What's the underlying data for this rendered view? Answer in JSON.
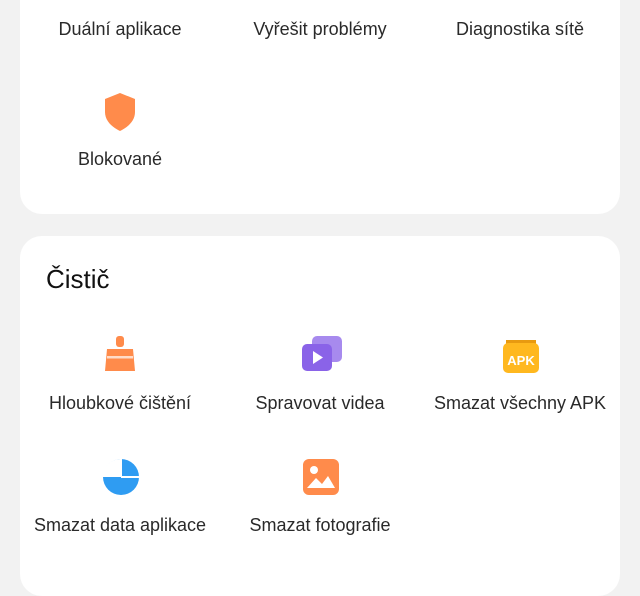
{
  "colors": {
    "page_background": "#f2f2f2",
    "card_background": "#ffffff",
    "orange": "#ff8b4b",
    "yellow": "#ffb81f",
    "blue": "#2f9cf2",
    "purple": "#8a63e8"
  },
  "top_section": {
    "items": [
      {
        "label": "Duální aplikace",
        "icon": "dual-apps-icon"
      },
      {
        "label": "Vyřešit problémy",
        "icon": "troubleshoot-icon"
      },
      {
        "label": "Diagnostika sítě",
        "icon": "network-diagnostics-icon"
      },
      {
        "label": "Blokované",
        "icon": "shield-icon"
      }
    ]
  },
  "cleaner_section": {
    "title": "Čistič",
    "items": [
      {
        "label": "Hloubkové čištění",
        "icon": "broom-icon"
      },
      {
        "label": "Spravovat videa",
        "icon": "video-stack-icon"
      },
      {
        "label": "Smazat všechny APK",
        "icon": "apk-icon",
        "badge_text": "APK"
      },
      {
        "label": "Smazat data aplikace",
        "icon": "pie-chart-icon"
      },
      {
        "label": "Smazat fotografie",
        "icon": "photo-icon"
      }
    ]
  }
}
